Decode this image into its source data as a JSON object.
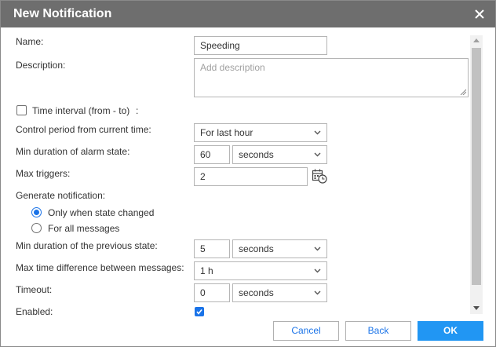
{
  "dialog": {
    "title": "New Notification"
  },
  "form": {
    "name_label": "Name:",
    "name_value": "Speeding",
    "description_label": "Description:",
    "description_placeholder": "Add description",
    "time_interval_label": "Time interval (from - to)",
    "time_interval_colon": ":",
    "time_interval_checked": false,
    "control_period_label": "Control period from current time:",
    "control_period_value": "For last hour",
    "min_duration_alarm_label": "Min duration of alarm state:",
    "min_duration_alarm_value": "60",
    "min_duration_alarm_unit": "seconds",
    "max_triggers_label": "Max triggers:",
    "max_triggers_value": "2",
    "generate_label": "Generate notification:",
    "generate_options": [
      "Only when state changed",
      "For all messages"
    ],
    "generate_selected": "Only when state changed",
    "min_duration_prev_label": "Min duration of the previous state:",
    "min_duration_prev_value": "5",
    "min_duration_prev_unit": "seconds",
    "max_time_diff_label": "Max time difference between messages:",
    "max_time_diff_value": "1 h",
    "timeout_label": "Timeout:",
    "timeout_value": "0",
    "timeout_unit": "seconds",
    "enabled_label": "Enabled:",
    "enabled_checked": true
  },
  "footer": {
    "cancel_label": "Cancel",
    "back_label": "Back",
    "ok_label": "OK"
  },
  "icons": {
    "close": "close-icon",
    "calendar": "calendar-clock-icon",
    "dropdown": "chevron-down-icon",
    "scroll_up": "scroll-up-arrow-icon",
    "scroll_down": "scroll-down-arrow-icon"
  },
  "colors": {
    "titlebar": "#6e6e6e",
    "accent": "#2196f3",
    "link": "#1a73e8"
  }
}
